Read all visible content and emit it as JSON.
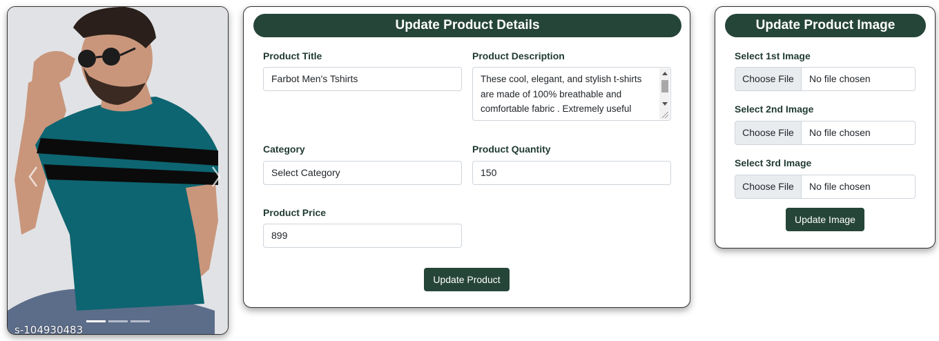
{
  "carousel": {
    "watermark": "s-104930483",
    "slide_count": 3,
    "active_slide": 1,
    "colors": {
      "shirt": "#0d6571",
      "stripe": "#0b0b0b",
      "background": "#dcdde1",
      "skin": "#c9967c",
      "jeans": "#5c6d8a"
    }
  },
  "details": {
    "title": "Update Product Details",
    "product_title_label": "Product Title",
    "product_title_value": "Farbot Men's Tshirts",
    "description_label": "Product Description",
    "description_value": "These cool, elegant, and stylish t-shirts are made of 100% breathable and comfortable fabric . Extremely useful",
    "category_label": "Category",
    "category_value": "Select Category",
    "quantity_label": "Product Quantity",
    "quantity_value": "150",
    "price_label": "Product Price",
    "price_value": "899",
    "submit_label": "Update Product"
  },
  "images": {
    "title": "Update Product Image",
    "fields": [
      {
        "label": "Select 1st Image",
        "button": "Choose File",
        "status": "No file chosen"
      },
      {
        "label": "Select 2nd Image",
        "button": "Choose File",
        "status": "No file chosen"
      },
      {
        "label": "Select 3rd Image",
        "button": "Choose File",
        "status": "No file chosen"
      }
    ],
    "submit_label": "Update Image"
  },
  "theme": {
    "accent": "#264539"
  }
}
